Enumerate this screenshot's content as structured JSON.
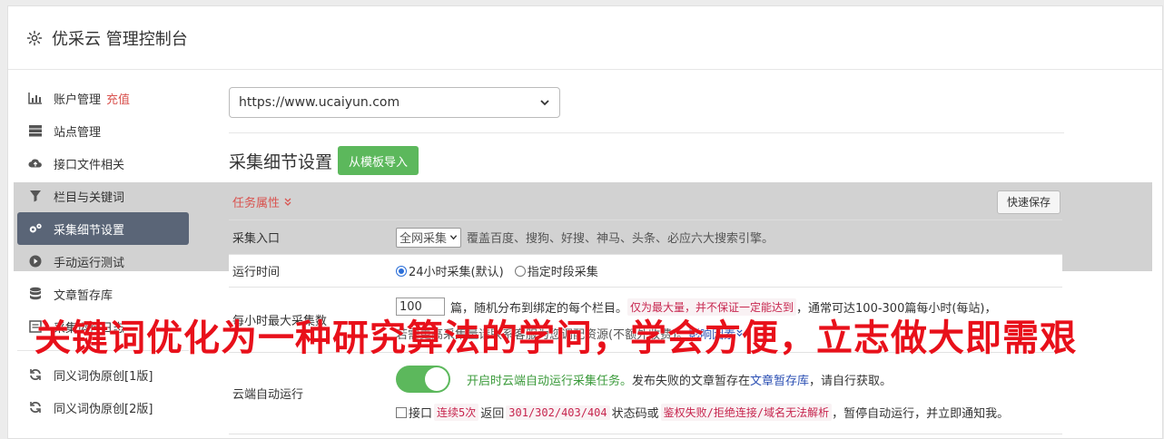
{
  "header": {
    "title": "优采云 管理控制台",
    "icon": "gear-icon"
  },
  "sidebar": {
    "items": [
      {
        "label": "账户管理",
        "badge": "充值",
        "icon": "bar-chart-icon"
      },
      {
        "label": "站点管理",
        "icon": "server-icon"
      },
      {
        "label": "接口文件相关",
        "icon": "cloud-upload-icon"
      },
      {
        "label": "栏目与关键词",
        "icon": "filter-icon"
      },
      {
        "label": "采集细节设置",
        "icon": "gears-icon",
        "active": true
      },
      {
        "label": "手动运行测试",
        "icon": "play-circle-icon"
      },
      {
        "label": "文章暂存库",
        "icon": "database-icon"
      },
      {
        "label": "采集运行日志",
        "icon": "log-icon"
      },
      {
        "label": "同义词伪原创[1版]",
        "icon": "refresh-icon"
      },
      {
        "label": "同义词伪原创[2版]",
        "icon": "refresh-icon"
      }
    ]
  },
  "main": {
    "site_select": "https://www.ucaiyun.com",
    "section_title": "采集细节设置",
    "import_button": "从模板导入",
    "task_tab": "任务属性",
    "quick_save": "快速保存",
    "rows": {
      "entry": {
        "label": "采集入口",
        "select": "全网采集",
        "desc": "覆盖百度、搜狗、好搜、神马、头条、必应六大搜索引擎。"
      },
      "runtime": {
        "label": "运行时间",
        "opt1": "24小时采集(默认)",
        "opt2": "指定时段采集"
      },
      "max": {
        "label": "每小时最大采集数",
        "value": "100",
        "text1": "篇，随机分布到绑定的每个栏目。",
        "code1": "仅为最大量，并不保证一定能达到",
        "text2": "，通常可达100-300篇每小时(每站)，",
        "text3": "若需更高采集量请联系客服为您调配资源(不额外收费)。",
        "link": "影响因素"
      },
      "cloud": {
        "label": "云端自动运行",
        "green": "开启时云端自动运行采集任务。",
        "text1": "发布失败的文章暂存在",
        "link": "文章暂存库",
        "text2": "，请自行获取。",
        "chk": "接口",
        "code1": "连续5次",
        "text3": "返回",
        "code2": "301/302/403/404",
        "text4": "状态码或",
        "code3": "鉴权失败/拒绝连接/域名无法解析",
        "text5": "，暂停自动运行，并立即通知我。"
      }
    }
  },
  "overlay_text": "关键词优化为一种研究算法的学问，学会方便，立志做大即需艰",
  "colors": {
    "active_bg": "#5a6577",
    "green": "#5cb85c",
    "red": "#d9534f",
    "overlay": "#e8101a"
  }
}
